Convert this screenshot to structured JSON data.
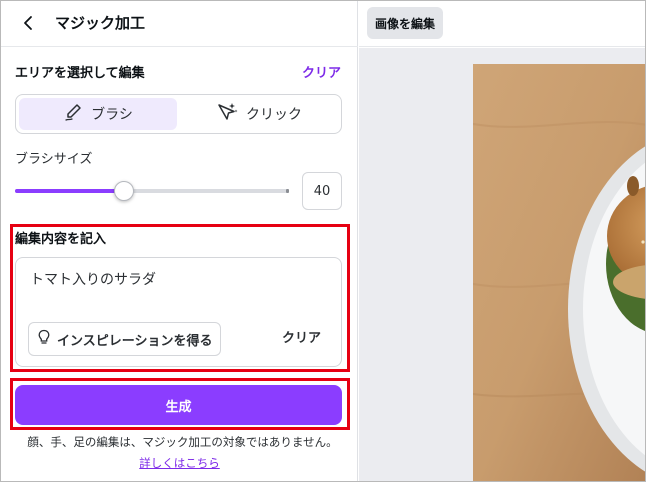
{
  "header": {
    "back_icon": "chevron-left-icon",
    "title": "マジック加工"
  },
  "area_select": {
    "title": "エリアを選択して編集",
    "clear_label": "クリア",
    "modes": [
      {
        "label": "ブラシ",
        "icon": "brush-icon",
        "selected": true
      },
      {
        "label": "クリック",
        "icon": "magic-click-icon",
        "selected": false
      }
    ]
  },
  "brush_size": {
    "label": "ブラシサイズ",
    "value": "40",
    "level_fraction": 0.4
  },
  "prompt": {
    "title": "編集内容を記入",
    "text": "トマト入りのサラダ",
    "inspire_label": "インスピレーションを得る",
    "inspire_icon": "lightbulb-icon",
    "clear_label": "クリア"
  },
  "generate_label": "生成",
  "notice": "顔、手、足の編集は、マジック加工の対象ではありません。",
  "learn_more": "詳しくはこちら",
  "topbar": {
    "edit_image_label": "画像を編集"
  },
  "colors": {
    "accent": "#8b3dff",
    "link": "#7d2ae8",
    "highlight": "#e60012",
    "segment_selected": "#efeafd"
  }
}
